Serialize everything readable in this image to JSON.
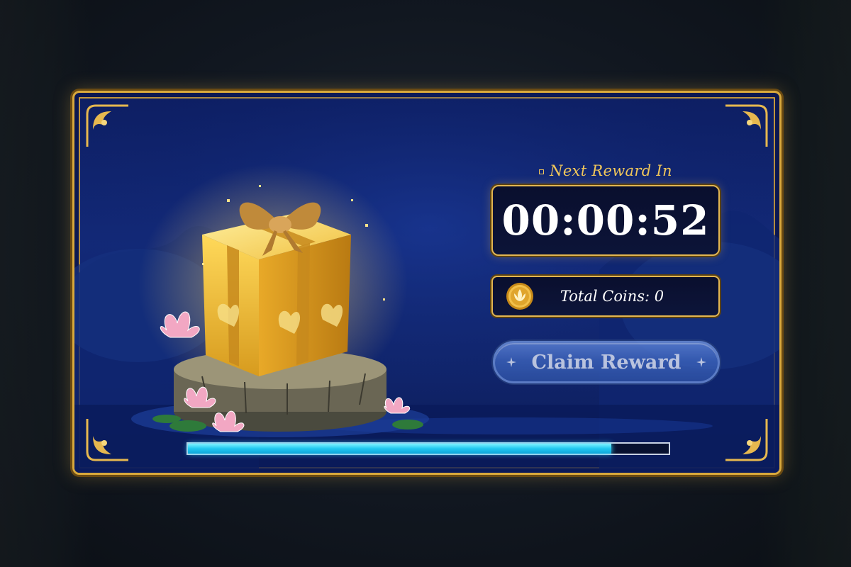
{
  "countdown": {
    "label": "Next Reward In",
    "time": "00:00:52"
  },
  "coins": {
    "label": "Total Coins: 0",
    "icon": "lotus-coin-icon"
  },
  "claim": {
    "label": "Claim Reward",
    "enabled": false
  },
  "progress": {
    "fraction": 0.88
  },
  "colors": {
    "gold": "#e3b651",
    "panel_blue": "#132a7a",
    "progress_cyan": "#20c8f0"
  }
}
